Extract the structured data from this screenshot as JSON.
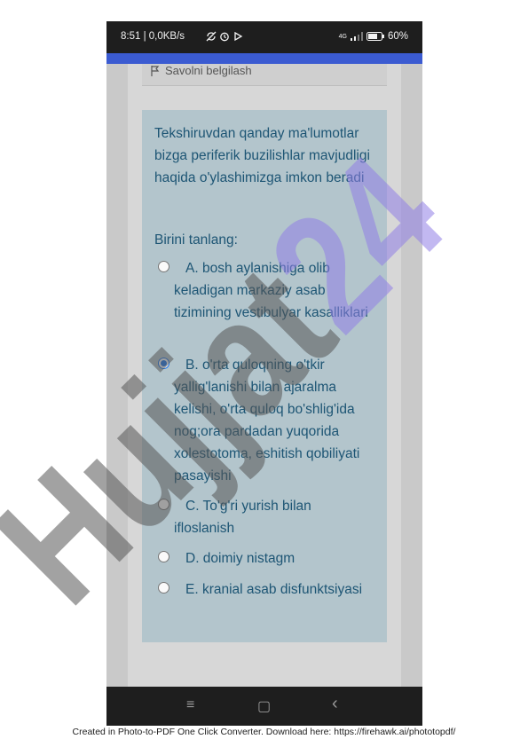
{
  "status_bar": {
    "time_speed": "8:51 | 0,0KB/s",
    "signal": "4G",
    "battery": "60%",
    "icons": [
      "no-sync-icon",
      "alarm-icon",
      "media-icon",
      "signal-icon",
      "battery-icon"
    ]
  },
  "flag": {
    "label": "Savolni belgilash",
    "icon": "flag-icon"
  },
  "question": {
    "text": "Tekshiruvdan qanday ma'lumotlar bizga periferik buzilishlar mavjudligi haqida o'ylashimizga imkon beradi",
    "prompt": "Birini tanlang:"
  },
  "options": [
    {
      "label": "A. bosh aylanishiga olib keladigan markaziy asab tizimining vestibulyar kasalliklari",
      "selected": false
    },
    {
      "label": "B. o'rta quloqning o'tkir yallig'lanishi bilan ajaralma kelishi, o'rta quloq bo'shlig'ida nog;ora pardadan yuqorida xolestotoma, eshitish qobiliyati pasayishi",
      "selected": true
    },
    {
      "label": "C. To'g'ri yurish bilan ifloslanish",
      "selected": false
    },
    {
      "label": "D. doimiy nistagm",
      "selected": false
    },
    {
      "label": "E. kranial asab disfunktsiyasi",
      "selected": false
    }
  ],
  "nav_bar": {
    "menu": "≡",
    "home": "▢",
    "back": "‹"
  },
  "watermark": {
    "text": "Hujjat24",
    "colors": [
      "#555555",
      "#8f7ee6"
    ]
  },
  "footer": {
    "text": "Created in Photo-to-PDF One Click Converter. Download here: https://firehawk.ai/phototopdf/"
  },
  "colors": {
    "accent_bar": "#3b5bd1",
    "card_bg": "#b3c5cc",
    "text": "#1d5574",
    "radio_selected": "#1a73e8"
  }
}
